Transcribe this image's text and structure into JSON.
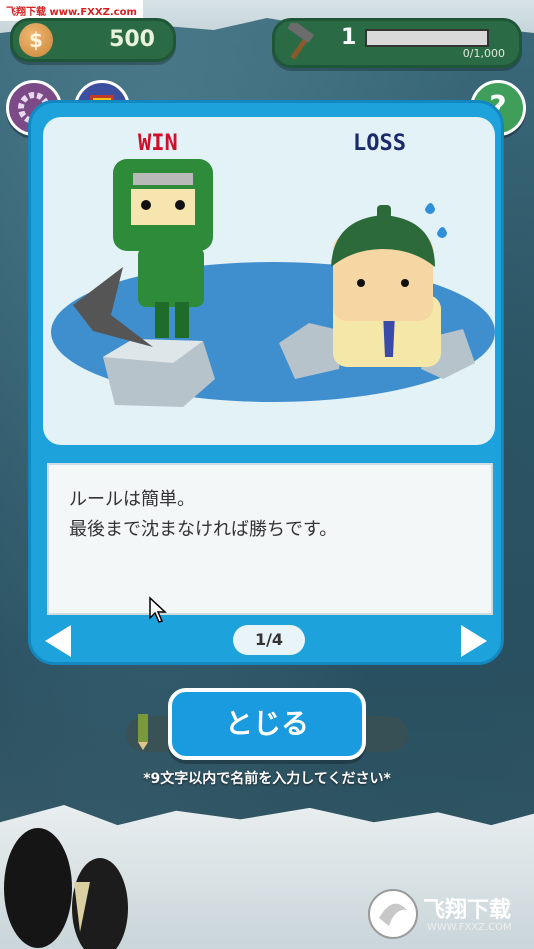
{
  "watermark_top": "飞翔下载 www.FXXZ.com",
  "watermark_bottom": {
    "brand": "飞翔下载",
    "url": "WWW.FXXZ.COM"
  },
  "hud": {
    "coins": "500",
    "coin_symbol": "$",
    "level": "1",
    "xp_text": "0/1,000",
    "xp_progress": 0.0
  },
  "buttons": {
    "help_glyph": "?"
  },
  "tutorial": {
    "win_label": "WIN",
    "loss_label": "LOSS",
    "text_line1": "ルールは簡単。",
    "text_line2": "最後まで沈まなければ勝ちです。",
    "page": "1/4"
  },
  "close_label": "とじる",
  "name_hint": "*9文字以内で名前を入力してください*",
  "colors": {
    "accent": "#1ea2dc",
    "win": "#d0102a",
    "loss": "#1a2a6b",
    "hud_green": "#2a6b46"
  }
}
